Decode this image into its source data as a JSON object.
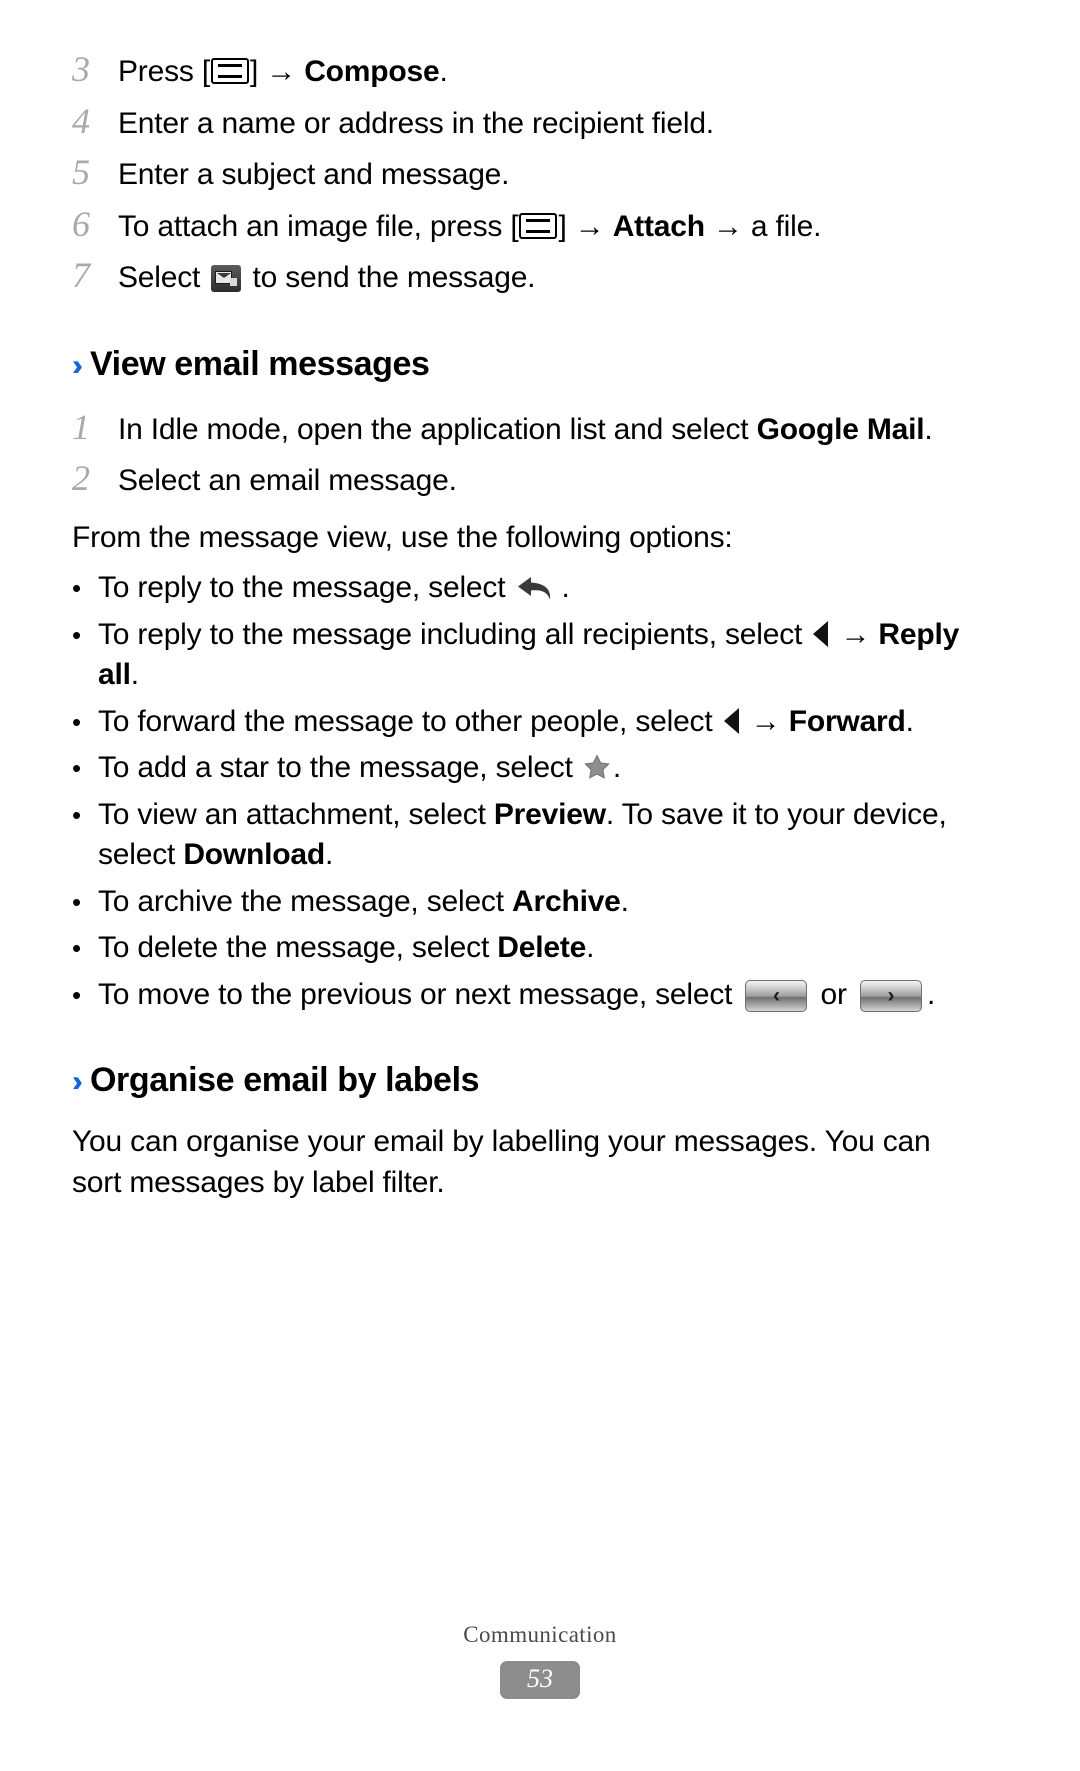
{
  "document": {
    "footer_label": "Communication",
    "page_number": "53",
    "accent_color": "#1566d6",
    "step_number_color": "#a9a9a9",
    "page_badge_color": "#8d8d8d"
  },
  "compose_steps": [
    {
      "number": "3",
      "pre": "Press [",
      "icon": "menu-key-icon",
      "mid": "] → ",
      "bold": "Compose",
      "post": "."
    },
    {
      "number": "4",
      "text": "Enter a name or address in the recipient field."
    },
    {
      "number": "5",
      "text": "Enter a subject and message."
    },
    {
      "number": "6",
      "pre": "To attach an image file, press [",
      "icon": "menu-key-icon",
      "mid": "] → ",
      "bold": "Attach",
      "post": " → a file."
    },
    {
      "number": "7",
      "pre": "Select ",
      "icon": "send-message-icon",
      "post": " to send the message."
    }
  ],
  "view_email_section": {
    "heading": "View email messages",
    "chevron": "››",
    "steps": [
      {
        "number": "1",
        "pre": "In Idle mode, open the application list and select ",
        "bold": "Google Mail",
        "post": "."
      },
      {
        "number": "2",
        "text": "Select an email message."
      }
    ],
    "intro": "From the message view, use the following options:",
    "bullet_marker": "•",
    "options": [
      {
        "id": "reply",
        "pre": "To reply to the message, select ",
        "icon": "reply-arrow-icon",
        "post": "."
      },
      {
        "id": "reply-all",
        "pre": "To reply to the message including all recipients, select ",
        "icon": "triangle-left-icon",
        "mid": " → ",
        "bold": "Reply all",
        "post": "."
      },
      {
        "id": "forward",
        "pre": "To forward the message to other people, select ",
        "icon": "triangle-left-icon",
        "mid": " → ",
        "bold": "Forward",
        "post": "."
      },
      {
        "id": "star",
        "pre": "To add a star to the message, select ",
        "icon": "star-icon",
        "post": "."
      },
      {
        "id": "preview-download",
        "pre": "To view an attachment, select ",
        "bold": "Preview",
        "mid": ". To save it to your device, select ",
        "bold2": "Download",
        "post": "."
      },
      {
        "id": "archive",
        "pre": "To archive the message, select ",
        "bold": "Archive",
        "post": "."
      },
      {
        "id": "delete",
        "pre": "To delete the message, select ",
        "bold": "Delete",
        "post": "."
      },
      {
        "id": "prev-next",
        "pre": "To move to the previous or next message, select ",
        "icon": "previous-message-button",
        "prev_glyph": "‹",
        "mid": " or ",
        "icon2": "next-message-button",
        "next_glyph": "›",
        "post": "."
      }
    ]
  },
  "organise_section": {
    "heading": "Organise email by labels",
    "chevron": "››",
    "paragraph": "You can organise your email by labelling your messages. You can sort messages by label filter."
  }
}
